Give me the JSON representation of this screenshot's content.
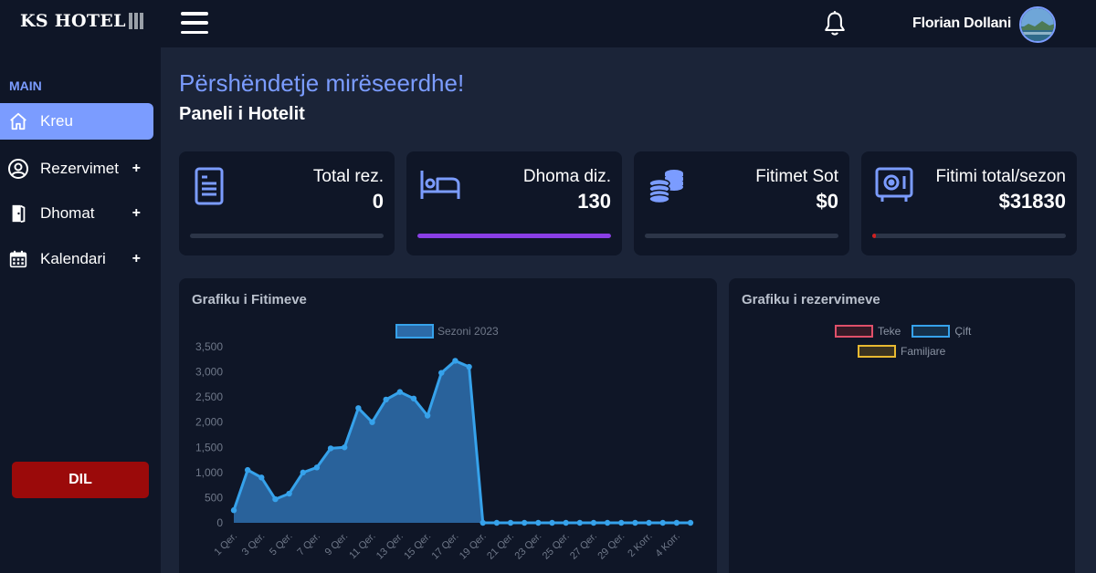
{
  "sidebar": {
    "logo": "KS HOTEL",
    "section_label": "MAIN",
    "items": [
      {
        "label": "Kreu",
        "icon": "home-icon",
        "active": true
      },
      {
        "label": "Rezervimet",
        "icon": "user-circle-icon",
        "expand": "+"
      },
      {
        "label": "Dhomat",
        "icon": "door-icon",
        "expand": "+"
      },
      {
        "label": "Kalendari",
        "icon": "calendar-icon",
        "expand": "+"
      }
    ],
    "logout_label": "DIL"
  },
  "topbar": {
    "user_name": "Florian Dollani"
  },
  "header": {
    "greeting": "Përshëndetje mirëseerdhe!",
    "subtitle": "Paneli i Hotelit"
  },
  "cards": [
    {
      "title": "Total rez.",
      "value": "0",
      "icon": "document-icon",
      "progress": 0,
      "color": "#2c3548"
    },
    {
      "title": "Dhoma diz.",
      "value": "130",
      "icon": "bed-icon",
      "progress": 1.0,
      "color": "#8a3ee6"
    },
    {
      "title": "Fitimet Sot",
      "value": "$0",
      "icon": "coins-icon",
      "progress": 0,
      "color": "#2c3548"
    },
    {
      "title": "Fitimi total/sezon",
      "value": "$31830",
      "icon": "safe-icon",
      "progress": 0.02,
      "color": "#d02020"
    }
  ],
  "colors": {
    "accent": "#7b9cff",
    "sidebar_bg": "#0f1627",
    "page_bg": "#1b2438",
    "logout": "#9b0a0a",
    "line": "#36a2eb",
    "area": "#2c6aa8"
  },
  "charts": {
    "left_title": "Grafiku i Fitimeve",
    "right_title": "Grafiku i rezervimeve"
  },
  "chart_data": [
    {
      "type": "area",
      "title": "Grafiku i Fitimeve",
      "series": [
        {
          "name": "Sezoni 2023",
          "values": [
            250,
            1050,
            900,
            470,
            580,
            1000,
            1100,
            1480,
            1500,
            2280,
            2000,
            2450,
            2600,
            2470,
            2130,
            2980,
            3220,
            3100,
            0,
            0,
            0,
            0,
            0,
            0,
            0,
            0,
            0,
            0,
            0,
            0,
            0,
            0,
            0,
            0
          ]
        }
      ],
      "x_tick_labels": [
        "1 Qer.",
        "3 Qer.",
        "5 Qer.",
        "7 Qer.",
        "9 Qer.",
        "11 Qer.",
        "13 Qer.",
        "15 Qer.",
        "17 Qer.",
        "19 Qer.",
        "21 Qer.",
        "23 Qer.",
        "25 Qer.",
        "27 Qer.",
        "29 Qer.",
        "2 Korr.",
        "4 Korr."
      ],
      "y_ticks": [
        0,
        500,
        1000,
        1500,
        2000,
        2500,
        3000,
        3500
      ],
      "y_tick_labels": [
        "0",
        "500",
        "1,000",
        "1,500",
        "2,000",
        "2,500",
        "3,000",
        "3,500"
      ],
      "ylim": [
        0,
        3500
      ],
      "legend": "top-center"
    },
    {
      "type": "bar",
      "title": "Grafiku i rezervimeve",
      "series": [
        {
          "name": "Teke",
          "values": [],
          "color": "#e0506a"
        },
        {
          "name": "Çift",
          "values": [],
          "color": "#36a2eb"
        },
        {
          "name": "Familjare",
          "values": [],
          "color": "#e8b931"
        }
      ],
      "legend": "top-center"
    }
  ]
}
